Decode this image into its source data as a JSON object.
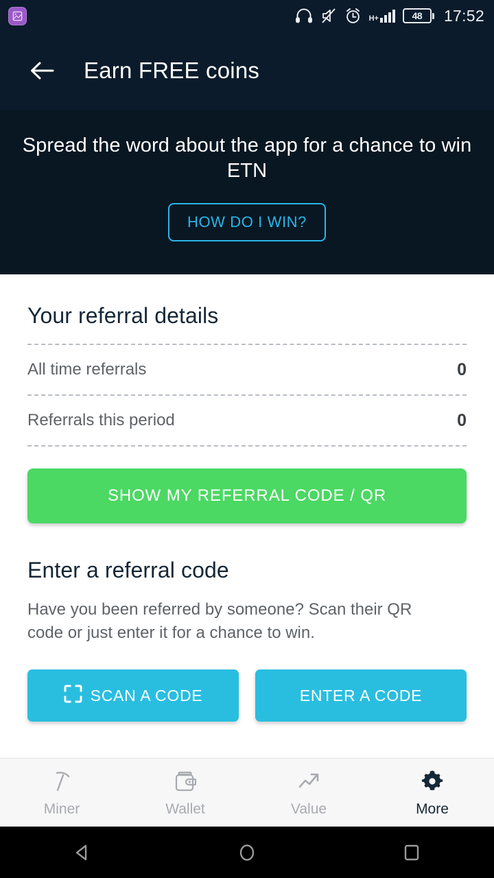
{
  "status_bar": {
    "notification_icon": "screenshot-app-icon",
    "icons": [
      "headphones-icon",
      "volume-mute-icon",
      "alarm-clock-icon",
      "hplus-signal-icon"
    ],
    "network_type": "H+",
    "battery_level": "48",
    "time": "17:52"
  },
  "app_bar": {
    "back_icon": "arrow-left-icon",
    "title": "Earn FREE coins"
  },
  "hero": {
    "headline": "Spread the word about the app for a chance to win ETN",
    "cta_label": "HOW DO I WIN?",
    "accent_color": "#29b6e8",
    "background_color": "#091722"
  },
  "referral_details": {
    "title": "Your referral details",
    "rows": [
      {
        "label": "All time referrals",
        "value": "0"
      },
      {
        "label": "Referrals this period",
        "value": "0"
      }
    ],
    "show_code_button": {
      "label": "SHOW MY REFERRAL CODE / QR",
      "color": "#4bd863"
    }
  },
  "enter_code": {
    "title": "Enter a referral code",
    "description": "Have you been referred by someone? Scan their QR code or just enter it for a chance to win.",
    "scan_button": {
      "label": "SCAN A CODE",
      "icon": "scan-frame-icon",
      "color": "#29bee0"
    },
    "enter_button": {
      "label": "ENTER A CODE",
      "color": "#29bee0"
    }
  },
  "tab_bar": {
    "tabs": [
      {
        "label": "Miner",
        "icon": "pickaxe-icon",
        "active": false
      },
      {
        "label": "Wallet",
        "icon": "wallet-icon",
        "active": false
      },
      {
        "label": "Value",
        "icon": "trending-up-icon",
        "active": false
      },
      {
        "label": "More",
        "icon": "gear-icon",
        "active": true
      }
    ],
    "active_color": "#152736",
    "inactive_color": "#a8abaf"
  },
  "nav_bar": {
    "back": "triangle-back-icon",
    "home": "circle-home-icon",
    "recents": "square-recents-icon"
  }
}
